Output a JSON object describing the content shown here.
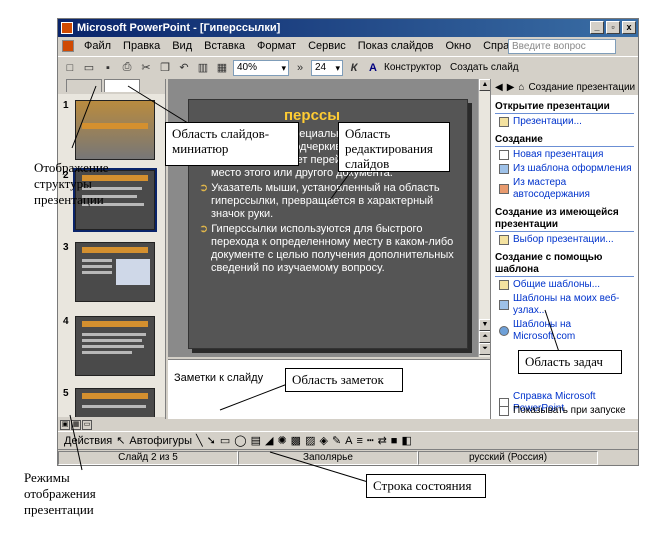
{
  "window": {
    "title": "Microsoft PowerPoint - [Гиперссылки]",
    "controls": [
      "_",
      "▫",
      "x"
    ]
  },
  "menu": {
    "items": [
      "Файл",
      "Правка",
      "Вид",
      "Вставка",
      "Формат",
      "Сервис",
      "Показ слайдов",
      "Окно",
      "Справка"
    ],
    "search_placeholder": "Введите вопрос"
  },
  "toolbar": {
    "zoom": "40%",
    "font_size": "24",
    "italic": "К",
    "font_color": "A",
    "designer": "Конструктор",
    "new_slide": "Создать слайд"
  },
  "left_pane": {
    "tabs": [
      "",
      ""
    ],
    "thumbnail_numbers": [
      "1",
      "2",
      "3",
      "4",
      "5"
    ]
  },
  "slide": {
    "title": "перссы",
    "paragraphs": [
      "оформленный специальным образом (обычно синего цвета с подчеркиванием), щелчок на котором позволяет перейти в определенное место этого или другого документа.",
      "Указатель мыши, установленный на область гиперссылки, превращается в характерный значок руки.",
      "Гиперссылки используются для быстрого перехода к определенному месту в каком-либо документе с целью получения дополнительных сведений по изучаемому вопросу."
    ]
  },
  "notes": {
    "placeholder": "Заметки к слайду"
  },
  "task_pane": {
    "title": "Создание презентации",
    "sections": [
      {
        "heading": "Открытие презентации",
        "links": [
          "Презентации..."
        ]
      },
      {
        "heading": "Создание",
        "links": [
          "Новая презентация",
          "Из шаблона оформления",
          "Из мастера автосодержания"
        ]
      },
      {
        "heading": "Создание из имеющейся презентации",
        "links": [
          "Выбор презентации..."
        ]
      },
      {
        "heading": "Создание с помощью шаблона",
        "links": [
          "Общие шаблоны...",
          "Шаблоны на моих веб-узлах...",
          "Шаблоны на Microsoft.com"
        ]
      }
    ],
    "help_link": "Справка Microsoft PowerPoint",
    "show_at_startup": "Показывать при запуске"
  },
  "draw_toolbar": {
    "actions": "Действия",
    "autoshapes": "Автофигуры"
  },
  "status_bar": {
    "slide_info": "Слайд 2 из 5",
    "design": "Заполярье",
    "language": "русский (Россия)"
  },
  "callouts": {
    "structure": "Отображение структуры презентации",
    "slides_thumbs": "Область слайдов-миниатюр",
    "editing": "Область редактирования слайдов",
    "task": "Область задач",
    "notes": "Область заметок",
    "status": "Строка состояния",
    "view_modes": "Режимы отображения презентации"
  },
  "colors": {
    "titlebar": "#0a246a",
    "slide_bg": "#555555",
    "slide_title": "#ffcc33",
    "link": "#0033cc"
  }
}
